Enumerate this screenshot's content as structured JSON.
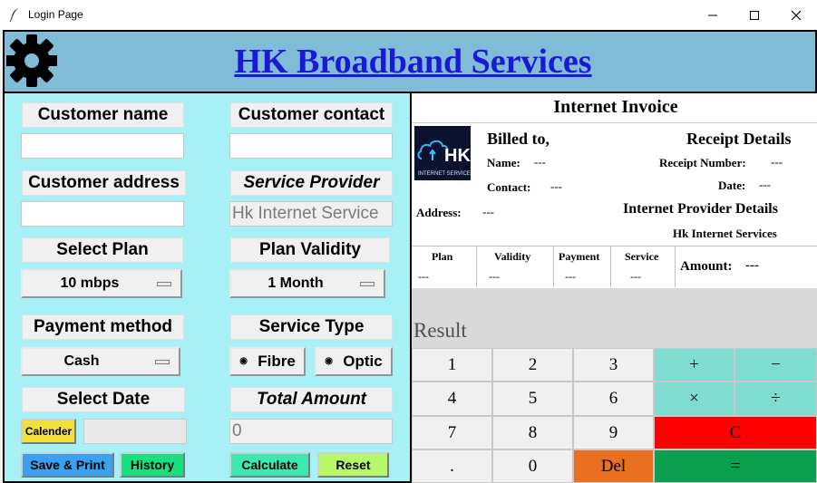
{
  "window": {
    "title": "Login Page"
  },
  "header": {
    "title": "HK Broadband Services"
  },
  "form": {
    "customer_name_label": "Customer name",
    "customer_contact_label": "Customer contact",
    "customer_address_label": "Customer address",
    "service_provider_label": "Service Provider",
    "service_provider_value": "Hk Internet Service",
    "select_plan_label": "Select Plan",
    "plan_value": "10 mbps",
    "plan_validity_label": "Plan Validity",
    "validity_value": "1 Month",
    "payment_method_label": "Payment method",
    "payment_value": "Cash",
    "service_type_label": "Service Type",
    "service_options": [
      "Fibre",
      "Optic"
    ],
    "select_date_label": "Select Date",
    "calendar_button": "Calender",
    "total_amount_label": "Total Amount",
    "total_amount_value": "0",
    "buttons": {
      "save_print": "Save & Print",
      "history": "History",
      "calculate": "Calculate",
      "reset": "Reset"
    }
  },
  "invoice": {
    "title": "Internet Invoice",
    "logo_text": "HK",
    "logo_subtext": "INTERNET SERVICE",
    "billed_to": "Billed to,",
    "name_label": "Name:",
    "name_value": "---",
    "contact_label": "Contact:",
    "contact_value": "---",
    "address_label": "Address:",
    "address_value": "---",
    "receipt_details": "Receipt Details",
    "receipt_number_label": "Receipt Number:",
    "receipt_number_value": "---",
    "date_label": "Date:",
    "date_value": "---",
    "provider_details": "Internet Provider Details",
    "provider_name": "Hk Internet Services",
    "columns": [
      "Plan",
      "Validity",
      "Payment",
      "Service"
    ],
    "column_values": [
      "---",
      "---",
      "---",
      "---"
    ],
    "amount_label": "Amount:",
    "amount_value": "---"
  },
  "calculator": {
    "display_label": "Result",
    "keys": [
      "1",
      "2",
      "3",
      "+",
      "−",
      "4",
      "5",
      "6",
      "×",
      "÷",
      "7",
      "8",
      "9",
      "C",
      ".",
      "0",
      "Del",
      "="
    ]
  },
  "colors": {
    "header_bg": "#80bcd8",
    "panel_bg": "#a7f0f5",
    "title_color": "#1b18d8",
    "op_key": "#7fdcd0",
    "clear_key": "#ff0000",
    "del_key": "#e87020",
    "equals_key": "#0aa050"
  }
}
